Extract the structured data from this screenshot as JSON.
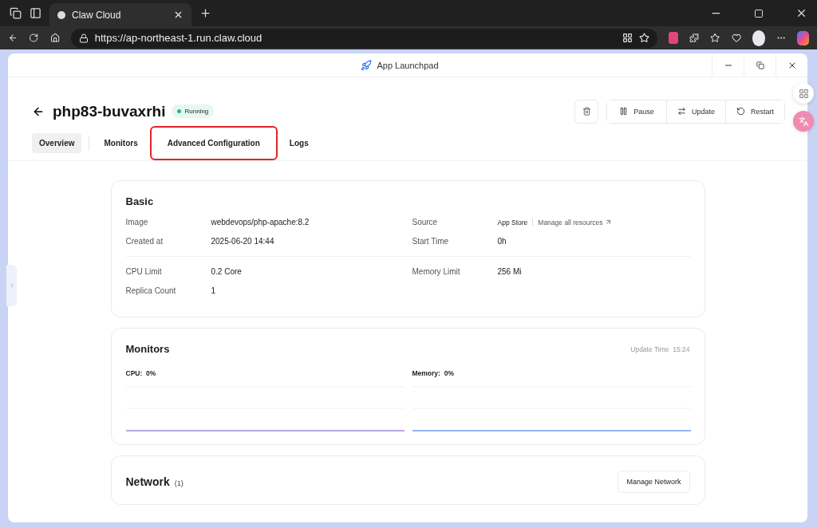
{
  "browser": {
    "tab_title": "Claw Cloud",
    "url": "https://ap-northeast-1.run.claw.cloud"
  },
  "window": {
    "title": "App Launchpad"
  },
  "app": {
    "name": "php83-buvaxrhi",
    "status": "Running",
    "actions": [
      {
        "label": "Pause",
        "kind": "pause"
      },
      {
        "label": "Update",
        "kind": "update"
      },
      {
        "label": "Restart",
        "kind": "restart"
      }
    ]
  },
  "tabs": [
    {
      "label": "Overview",
      "selected": true,
      "highlighted": false
    },
    {
      "label": "Monitors",
      "selected": false,
      "highlighted": false
    },
    {
      "label": "Advanced Configuration",
      "selected": false,
      "highlighted": true
    },
    {
      "label": "Logs",
      "selected": false,
      "highlighted": false
    }
  ],
  "basic": {
    "title": "Basic",
    "groups": [
      [
        {
          "label": "Image",
          "value": "webdevops/php-apache:8.2"
        },
        {
          "label": "Source",
          "value": "App Store",
          "link": "Manage all resources"
        },
        {
          "label": "Created at",
          "value": "2025-06-20 14:44"
        },
        {
          "label": "Start Time",
          "value": "0h"
        }
      ],
      [
        {
          "label": "CPU Limit",
          "value": "0.2 Core"
        },
        {
          "label": "Memory Limit",
          "value": "256 Mi"
        },
        {
          "label": "Replica Count",
          "value": "1"
        }
      ]
    ]
  },
  "monitors": {
    "title": "Monitors",
    "update_label": "Update Time",
    "update_time": "15:24",
    "items": [
      {
        "label": "CPU:",
        "value": "0%",
        "color": "#b9a6ec"
      },
      {
        "label": "Memory:",
        "value": "0%",
        "color": "#93b4f5"
      }
    ]
  },
  "network": {
    "title": "Network",
    "count": "(1)",
    "button": "Manage Network"
  }
}
